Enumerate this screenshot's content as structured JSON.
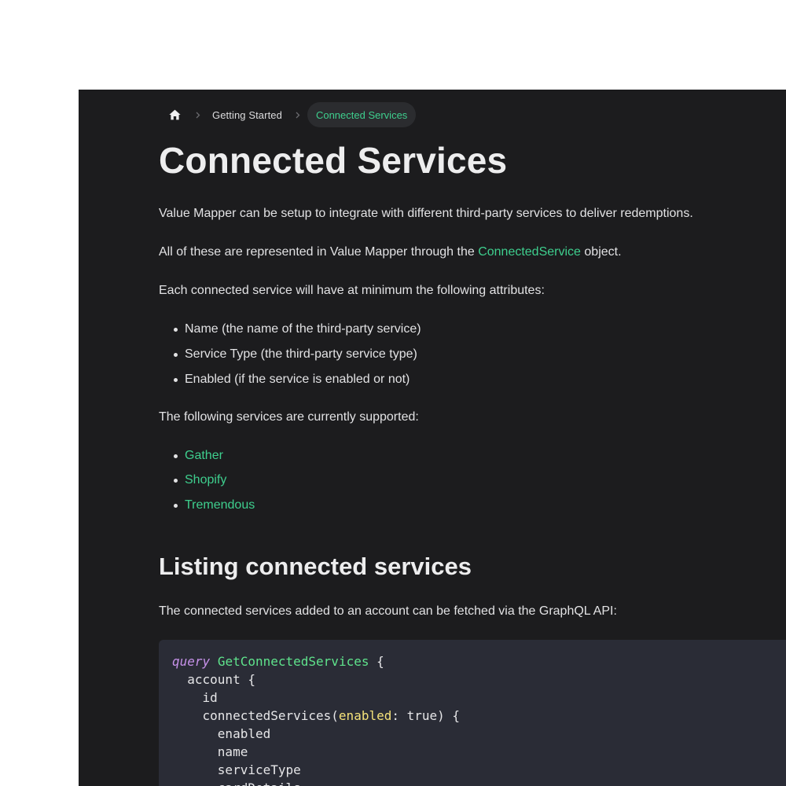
{
  "breadcrumb": {
    "home_icon": "home-icon",
    "separator_icon": "chevron-right-icon",
    "items": [
      "Getting Started",
      "Connected Services"
    ]
  },
  "page": {
    "title": "Connected Services",
    "intro": "Value Mapper can be setup to integrate with different third-party services to deliver redemptions.",
    "represented_prefix": "All of these are represented in Value Mapper through the",
    "represented_link": "ConnectedService",
    "represented_suffix": "object.",
    "attributes_intro": "Each connected service will have at minimum the following attributes:",
    "attributes": [
      "Name (the name of the third-party service)",
      "Service Type (the third-party service type)",
      "Enabled (if the service is enabled or not)"
    ],
    "supported_intro": "The following services are currently supported:",
    "supported_services": [
      "Gather",
      "Shopify",
      "Tremendous"
    ]
  },
  "section": {
    "title": "Listing connected services",
    "description": "The connected services added to an account can be fetched via the GraphQL API:"
  },
  "code": {
    "keyword": "query",
    "operation_name": "GetConnectedServices",
    "line1_tail": " {",
    "line2": "  account {",
    "line3": "    id",
    "line4_field": "    connectedServices(",
    "line4_arg": "enabled",
    "line4_tail": ": true) {",
    "line5": "      enabled",
    "line6": "      name",
    "line7": "      serviceType",
    "line8": "      cardDetails"
  },
  "colors": {
    "panel_background": "#1c1c1e",
    "accent": "#3ecf8e",
    "code_background": "#2a2c36",
    "code_keyword": "#c792ea",
    "code_name": "#5fe38c",
    "code_argument": "#f5e27a"
  }
}
